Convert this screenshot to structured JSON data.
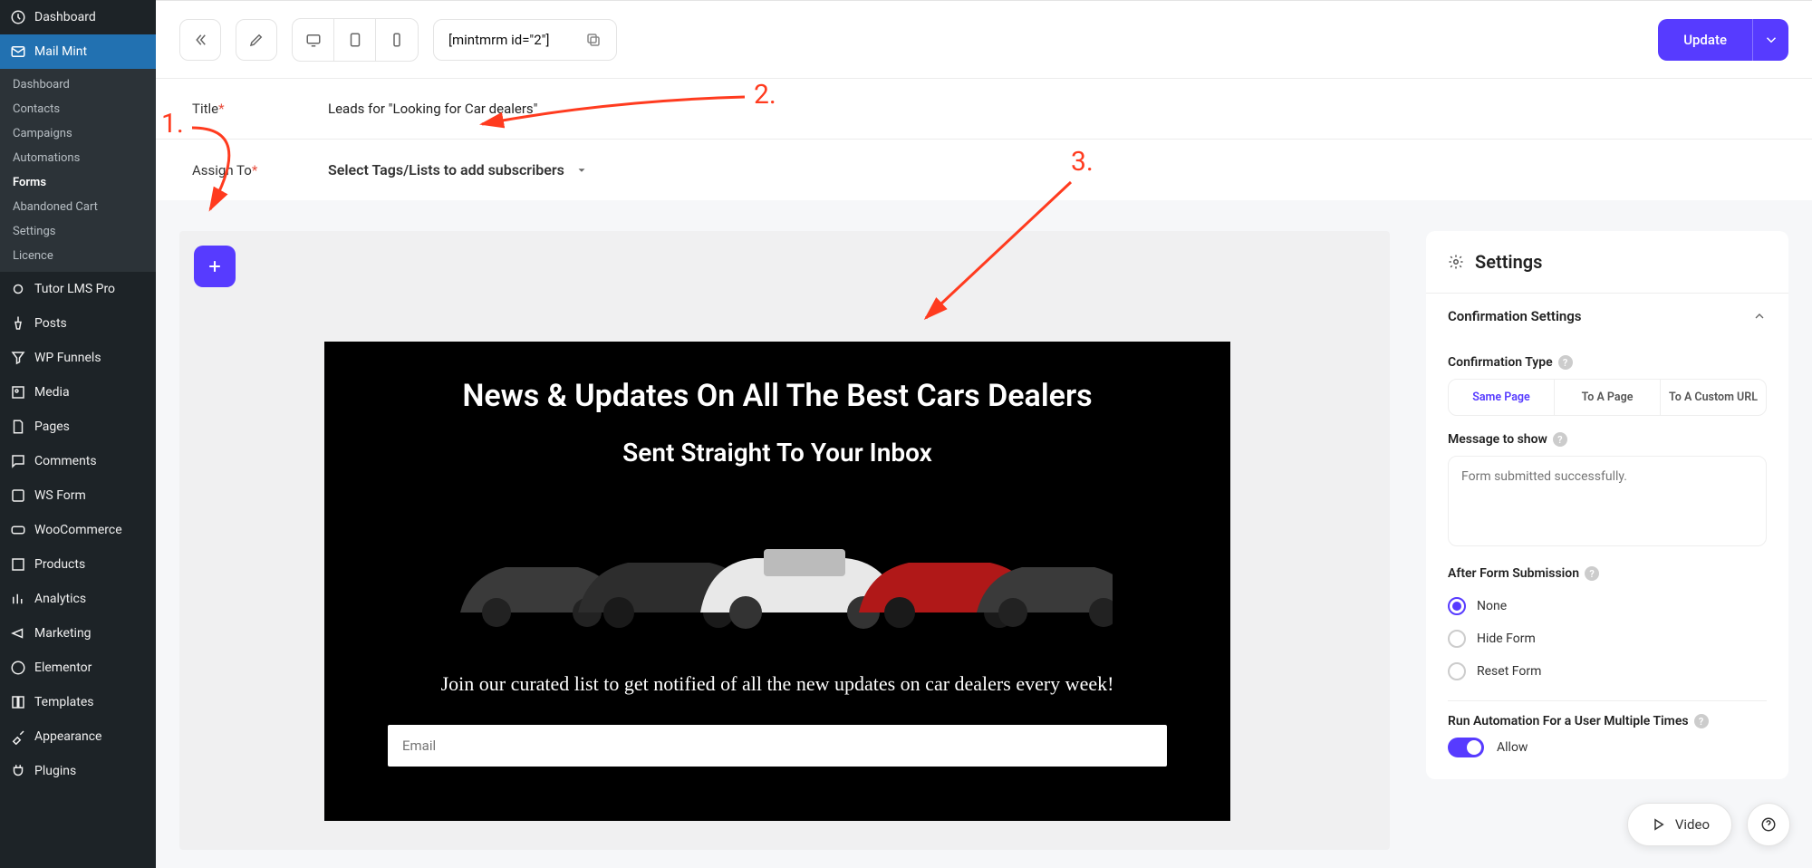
{
  "sidebar": {
    "top": "Dashboard",
    "current": "Mail Mint",
    "submenu": [
      "Dashboard",
      "Contacts",
      "Campaigns",
      "Automations",
      "Forms",
      "Abandoned Cart",
      "Settings",
      "Licence"
    ],
    "active_sub": "Forms",
    "items": [
      "Tutor LMS Pro",
      "Posts",
      "WP Funnels",
      "Media",
      "Pages",
      "Comments",
      "WS Form",
      "WooCommerce",
      "Products",
      "Analytics",
      "Marketing",
      "Elementor",
      "Templates",
      "Appearance",
      "Plugins"
    ]
  },
  "topbar": {
    "shortcode": "[mintmrm id=\"2\"]",
    "update": "Update"
  },
  "fields": {
    "title_label": "Title",
    "title_value": "Leads for \"Looking for Car dealers\"",
    "assign_label": "Assign To",
    "assign_placeholder": "Select Tags/Lists to add subscribers"
  },
  "preview": {
    "h1": "News & Updates On All The Best Cars Dealers",
    "h2": "Sent Straight To Your Inbox",
    "sub": "Join our curated list to get notified of all the new updates on car dealers every week!",
    "email_placeholder": "Email"
  },
  "settings": {
    "title": "Settings",
    "section": "Confirmation Settings",
    "conf_type_label": "Confirmation Type",
    "tabs": [
      "Same Page",
      "To A Page",
      "To A Custom URL"
    ],
    "msg_label": "Message to show",
    "msg_placeholder": "Form submitted successfully.",
    "after_label": "After Form Submission",
    "radios": [
      "None",
      "Hide Form",
      "Reset Form"
    ],
    "automation_label": "Run Automation For a User Multiple Times",
    "allow": "Allow"
  },
  "floating": {
    "video": "Video"
  },
  "annotations": {
    "one": "1.",
    "two": "2.",
    "three": "3."
  }
}
